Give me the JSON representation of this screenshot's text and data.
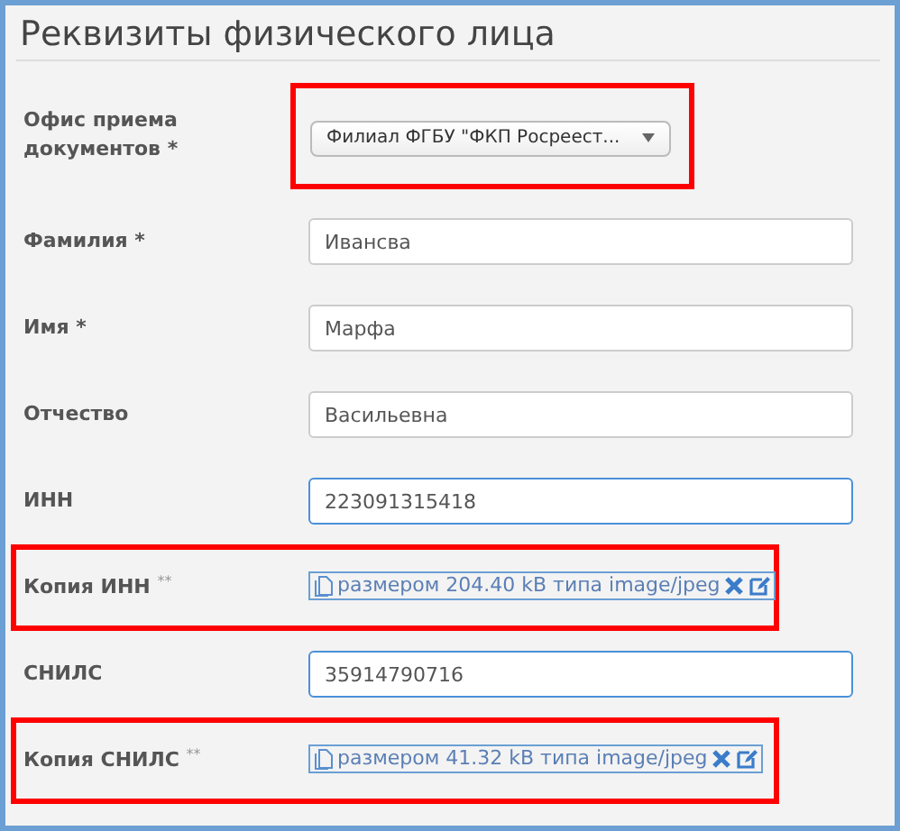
{
  "title": "Реквизиты физического лица",
  "fields": [
    {
      "kind": "select",
      "label": "Офис приема документов *",
      "value": "Филиал ФГБУ \"ФКП Росреест...",
      "annotated": true
    },
    {
      "kind": "text",
      "label": "Фамилия *",
      "value": "Ивансва",
      "highlighted": false
    },
    {
      "kind": "text",
      "label": "Имя *",
      "value": "Марфа",
      "highlighted": false
    },
    {
      "kind": "text",
      "label": "Отчество",
      "value": "Васильевна",
      "highlighted": false
    },
    {
      "kind": "text",
      "label": "ИНН",
      "value": "223091315418",
      "highlighted": true
    },
    {
      "kind": "file",
      "label": "Копия ИНН $^{**}$",
      "value": "размером 204.40 kB типа image/jpeg",
      "annotated": true
    },
    {
      "kind": "text",
      "label": "СНИЛС",
      "value": "35914790716",
      "highlighted": true
    },
    {
      "kind": "file",
      "label": "Копия СНИЛС $^{**}$",
      "value": "размером 41.32 kB типа image/jpeg",
      "annotated": true
    }
  ]
}
